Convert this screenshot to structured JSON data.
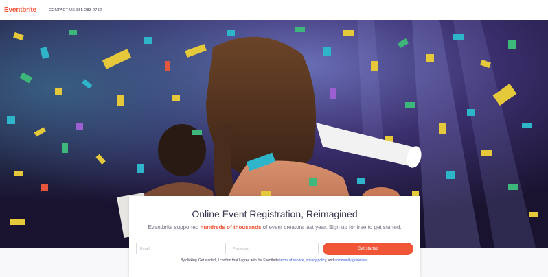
{
  "header": {
    "logo": "Eventbrite",
    "contact": "CONTACT US 855 283 2782"
  },
  "hero": {
    "image_description_icon": "concert-confetti-photo"
  },
  "signup": {
    "headline": "Online Event Registration, Reimagined",
    "subtitle_before": "Eventbrite supported ",
    "subtitle_highlight": "hundreds of thousands",
    "subtitle_after": " of event creators last year. Sign up for free to get started.",
    "email_placeholder": "Email",
    "password_placeholder": "Password",
    "cta_label": "Get started",
    "terms_prefix": "By clicking 'Get started', I confirm that I agree with the Eventbrite ",
    "terms_link": "terms of service",
    "sep1": ", ",
    "privacy_link": "privacy policy",
    "sep2": ", and ",
    "guidelines_link": "community guidelines",
    "terms_suffix": "."
  },
  "colors": {
    "brand": "#f05537",
    "link": "#3659e3",
    "text": "#39364f"
  }
}
